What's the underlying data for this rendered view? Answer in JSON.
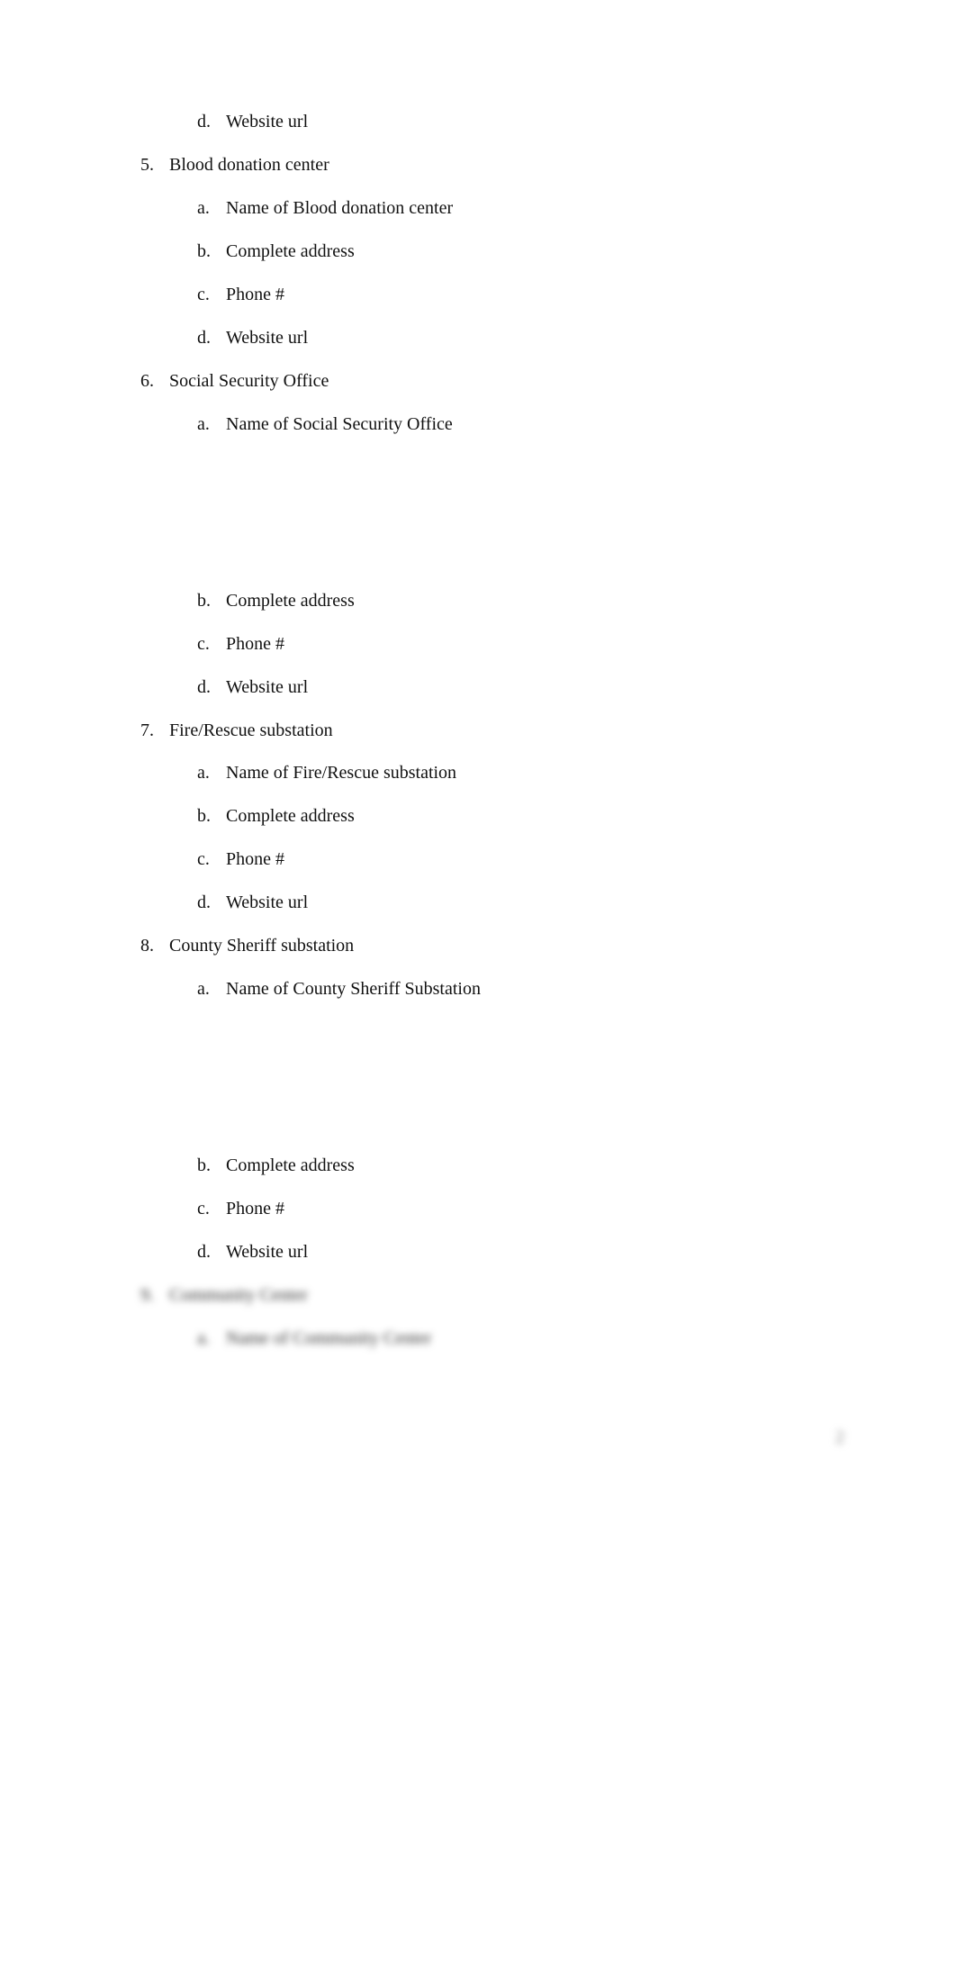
{
  "lines": [
    {
      "level": 2,
      "marker": "d.",
      "text": "Website url"
    },
    {
      "level": 1,
      "marker": "5.",
      "text": "Blood donation center"
    },
    {
      "level": 2,
      "marker": "a.",
      "text": "Name of Blood donation center"
    },
    {
      "level": 2,
      "marker": "b.",
      "text": "Complete address"
    },
    {
      "level": 2,
      "marker": "c.",
      "text": "Phone #"
    },
    {
      "level": 2,
      "marker": "d.",
      "text": "Website url"
    },
    {
      "level": 1,
      "marker": "6.",
      "text": "Social Security Office"
    },
    {
      "level": 2,
      "marker": "a.",
      "text": "Name of Social Security Office"
    },
    {
      "level": 2,
      "marker": "b.",
      "text": "Complete address"
    },
    {
      "level": 2,
      "marker": "c.",
      "text": "Phone #"
    },
    {
      "level": 2,
      "marker": "d.",
      "text": "Website url"
    },
    {
      "level": 1,
      "marker": "7.",
      "text": "Fire/Rescue substation"
    },
    {
      "level": 2,
      "marker": "a.",
      "text": "Name of Fire/Rescue substation"
    },
    {
      "level": 2,
      "marker": "b.",
      "text": "Complete address"
    },
    {
      "level": 2,
      "marker": "c.",
      "text": "Phone #"
    },
    {
      "level": 2,
      "marker": "d.",
      "text": "Website url"
    },
    {
      "level": 1,
      "marker": "8.",
      "text": "County Sheriff substation"
    },
    {
      "level": 2,
      "marker": "a.",
      "text": "Name of County Sheriff Substation"
    },
    {
      "level": 2,
      "marker": "b.",
      "text": "Complete address"
    },
    {
      "level": 2,
      "marker": "c.",
      "text": "Phone #"
    },
    {
      "level": 2,
      "marker": "d.",
      "text": "Website url"
    },
    {
      "level": 1,
      "marker": "9.",
      "text": "Community Center",
      "blurred": true
    },
    {
      "level": 2,
      "marker": "a.",
      "text": "Name of Community Center",
      "blurred": true
    }
  ],
  "page_number": "2"
}
